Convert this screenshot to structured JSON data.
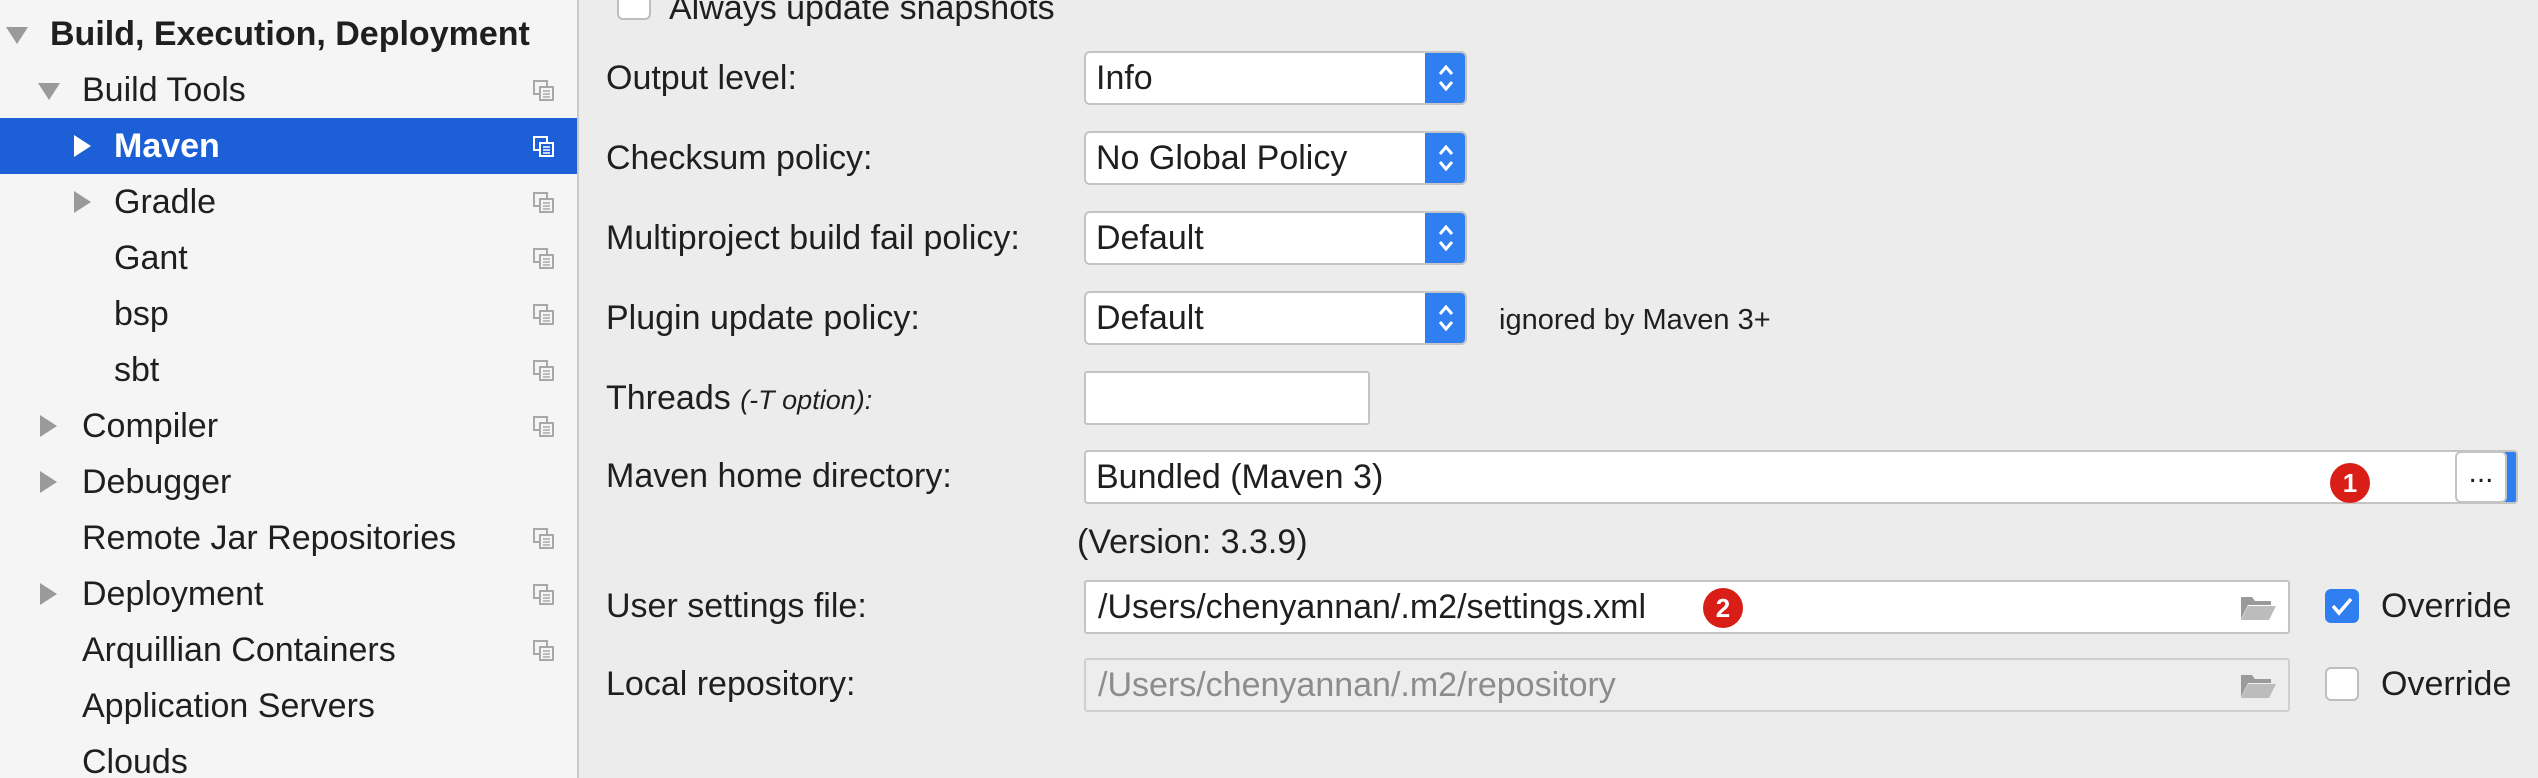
{
  "sidebar": {
    "items": [
      {
        "label": "Build, Execution, Deployment"
      },
      {
        "label": "Build Tools"
      },
      {
        "label": "Maven"
      },
      {
        "label": "Gradle"
      },
      {
        "label": "Gant"
      },
      {
        "label": "bsp"
      },
      {
        "label": "sbt"
      },
      {
        "label": "Compiler"
      },
      {
        "label": "Debugger"
      },
      {
        "label": "Remote Jar Repositories"
      },
      {
        "label": "Deployment"
      },
      {
        "label": "Arquillian Containers"
      },
      {
        "label": "Application Servers"
      },
      {
        "label": "Clouds"
      }
    ]
  },
  "settings": {
    "always_update_snapshots": {
      "label": "Always update snapshots",
      "checked": false
    },
    "output_level": {
      "label": "Output level:",
      "value": "Info"
    },
    "checksum_policy": {
      "label": "Checksum policy:",
      "value": "No Global Policy"
    },
    "multiproject_fail_policy": {
      "label": "Multiproject build fail policy:",
      "value": "Default"
    },
    "plugin_update_policy": {
      "label": "Plugin update policy:",
      "value": "Default",
      "note": "ignored by Maven 3+"
    },
    "threads": {
      "label": "Threads",
      "hint": "(-T option):",
      "value": ""
    },
    "maven_home": {
      "label": "Maven home directory:",
      "value": "Bundled (Maven 3)",
      "badge": "1",
      "browse": "...",
      "version": "(Version: 3.3.9)"
    },
    "user_settings": {
      "label": "User settings file:",
      "value": "/Users/chenyannan/.m2/settings.xml",
      "badge": "2",
      "override_label": "Override",
      "override_checked": true
    },
    "local_repository": {
      "label": "Local repository:",
      "value": "/Users/chenyannan/.m2/repository",
      "override_label": "Override",
      "override_checked": false
    }
  },
  "colors": {
    "selection": "#1d5fd6",
    "accent": "#2f7ff0",
    "badge": "#d91e18"
  }
}
